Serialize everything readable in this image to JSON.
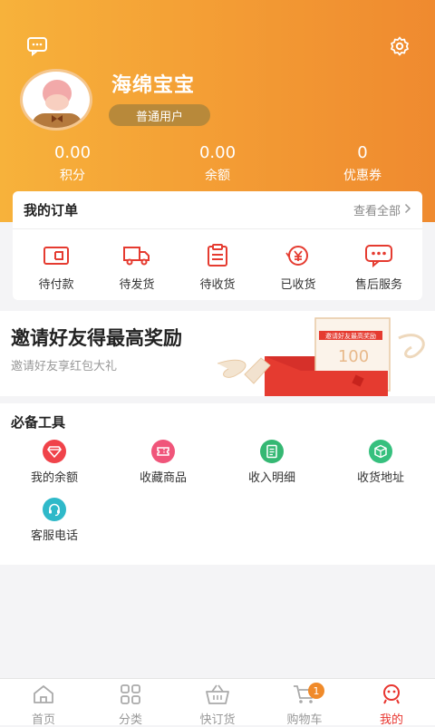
{
  "profile": {
    "username": "海绵宝宝",
    "level": "普通用户"
  },
  "stats": [
    {
      "value": "0.00",
      "label": "积分"
    },
    {
      "value": "0.00",
      "label": "余额"
    },
    {
      "value": "0",
      "label": "优惠券"
    }
  ],
  "orders": {
    "title": "我的订单",
    "view_all": "查看全部",
    "items": [
      {
        "label": "待付款",
        "icon": "wallet-icon"
      },
      {
        "label": "待发货",
        "icon": "truck-icon"
      },
      {
        "label": "待收货",
        "icon": "clipboard-icon"
      },
      {
        "label": "已收货",
        "icon": "yuan-icon"
      },
      {
        "label": "售后服务",
        "icon": "chat-icon"
      }
    ]
  },
  "invite": {
    "title": "邀请好友得最高奖励",
    "subtitle": "邀请好友享红包大礼",
    "card_text": "邀请好友最高奖励",
    "card_amount": "100"
  },
  "tools": {
    "title": "必备工具",
    "items": [
      {
        "label": "我的余额",
        "icon": "diamond-icon",
        "color": "#f0434a"
      },
      {
        "label": "收藏商品",
        "icon": "ticket-icon",
        "color": "#f0557a"
      },
      {
        "label": "收入明细",
        "icon": "document-icon",
        "color": "#35b873"
      },
      {
        "label": "收货地址",
        "icon": "box-icon",
        "color": "#36c07e"
      },
      {
        "label": "客服电话",
        "icon": "headset-icon",
        "color": "#2fb9c9"
      }
    ]
  },
  "tabbar": {
    "items": [
      {
        "label": "首页",
        "icon": "home-icon"
      },
      {
        "label": "分类",
        "icon": "grid-icon"
      },
      {
        "label": "快订货",
        "icon": "basket-icon"
      },
      {
        "label": "购物车",
        "icon": "cart-icon",
        "badge": "1"
      },
      {
        "label": "我的",
        "icon": "profile-icon",
        "active": true
      }
    ]
  },
  "colors": {
    "header_start": "#f7b23b",
    "header_end": "#ef8a2f",
    "accent_red": "#e8352f"
  }
}
